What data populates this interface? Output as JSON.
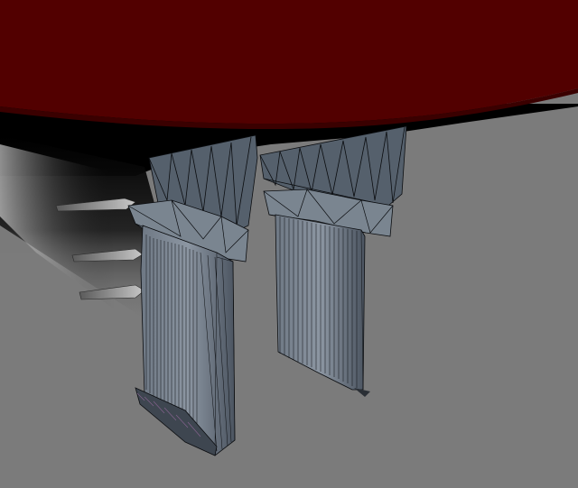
{
  "scene": {
    "view": "3d-wireframe-render",
    "background_color": "#7b7b7b",
    "hull_color": "#520000",
    "shadow_color": "#000000",
    "mesh_fill_color": "#59636f",
    "mesh_wire_color": "#0b0d10",
    "objects": [
      "hull-underside",
      "shadow-region",
      "pontoon-fins",
      "rudder-left",
      "rudder-right"
    ]
  }
}
